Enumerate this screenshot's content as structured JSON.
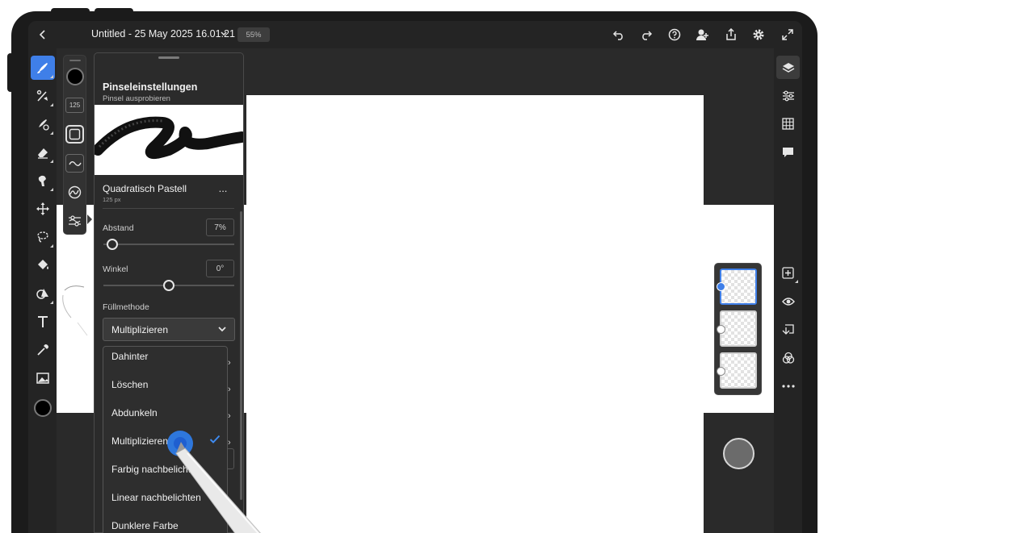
{
  "app": {
    "document_title": "Untitled - 25 May 2025 16.01.21",
    "zoom": "55%",
    "colors": {
      "accent": "#3f7fe8",
      "toolbar_bg": "#242424",
      "panel_bg": "#2b2b2b"
    }
  },
  "top_bar": {
    "icons": [
      "back-icon",
      "title-chevron-icon",
      "undo-icon",
      "redo-icon",
      "help-icon",
      "share-user-icon",
      "export-icon",
      "settings-icon",
      "fullscreen-icon"
    ]
  },
  "left_toolbar": {
    "tools": [
      "paint-brush-tool",
      "pixel-brush-tool",
      "adjustment-brush-tool",
      "eraser-tool",
      "smudge-tool",
      "move-tool",
      "lasso-tool",
      "fill-tool",
      "shape-tool",
      "type-tool",
      "eyedropper-tool",
      "place-image-tool",
      "color-swatch"
    ],
    "active_tool": "paint-brush-tool"
  },
  "sub_toolbar": {
    "brush_size": "125",
    "icons": [
      "brush-color-swatch",
      "brush-shape-icon",
      "brush-stroke-icon",
      "brush-flow-icon",
      "brush-settings-icon"
    ]
  },
  "brush_panel": {
    "title": "Pinseleinstellungen",
    "subtitle": "Pinsel ausprobieren",
    "brush_name": "Quadratisch Pastell",
    "brush_size": "125 px",
    "more_label": "...",
    "spacing": {
      "label": "Abstand",
      "value": "7%",
      "fraction": 0.07
    },
    "angle": {
      "label": "Winkel",
      "value": "0°",
      "fraction": 0.5
    },
    "blend_mode": {
      "label": "Füllmethode",
      "selected": "Multiplizieren"
    },
    "blend_options": [
      "Dahinter",
      "Löschen",
      "Abdunkeln",
      "Multiplizieren",
      "Farbig nachbelichten",
      "Linear nachbelichten",
      "Dunklere Farbe"
    ],
    "checked_option": "Multiplizieren"
  },
  "right_panel": {
    "top_icons": [
      "layers-icon",
      "adjustments-icon",
      "grid-icon",
      "comments-icon"
    ],
    "bottom_icons": [
      "add-layer-icon",
      "visibility-icon",
      "layer-properties-icon",
      "blend-icon",
      "more-icon"
    ],
    "layers": [
      {
        "name": "layer-1",
        "selected": true
      },
      {
        "name": "layer-2",
        "selected": false
      },
      {
        "name": "layer-3",
        "selected": false
      }
    ]
  }
}
